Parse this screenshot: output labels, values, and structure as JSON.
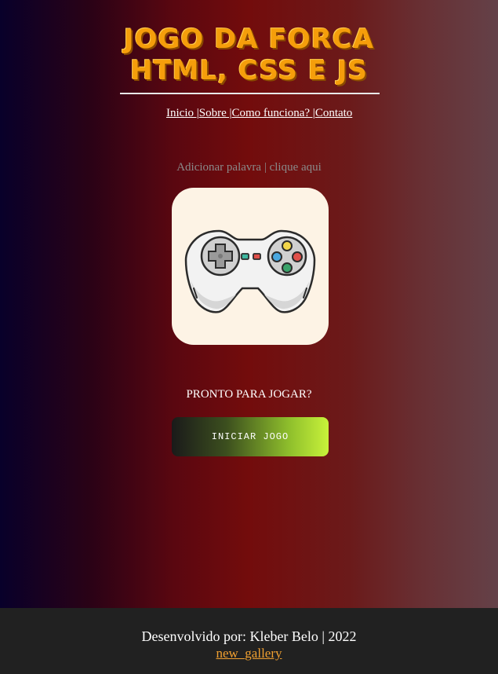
{
  "header": {
    "title_line1": "JOGO DA FORCA",
    "title_line2": "HTML, CSS E JS"
  },
  "nav": {
    "items": [
      {
        "label": "Inicio |"
      },
      {
        "label": "Sobre |"
      },
      {
        "label": "Como funciona? |"
      },
      {
        "label": "Contato"
      }
    ]
  },
  "main": {
    "add_word_text": "Adicionar palavra | clique aqui",
    "game_icon": "gamepad-icon",
    "ready_text": "PRONTO PARA JOGAR?",
    "start_button_label": "INICIAR JOGO"
  },
  "footer": {
    "credit": "Desenvolvido por: Kleber Belo | 2022",
    "link_label": "new_gallery"
  },
  "colors": {
    "title": "#f59e0b",
    "footer_bg": "#212121",
    "footer_link": "#f0a030",
    "card_bg": "#fdf3e5",
    "button_gradient_end": "#c8f23a"
  }
}
